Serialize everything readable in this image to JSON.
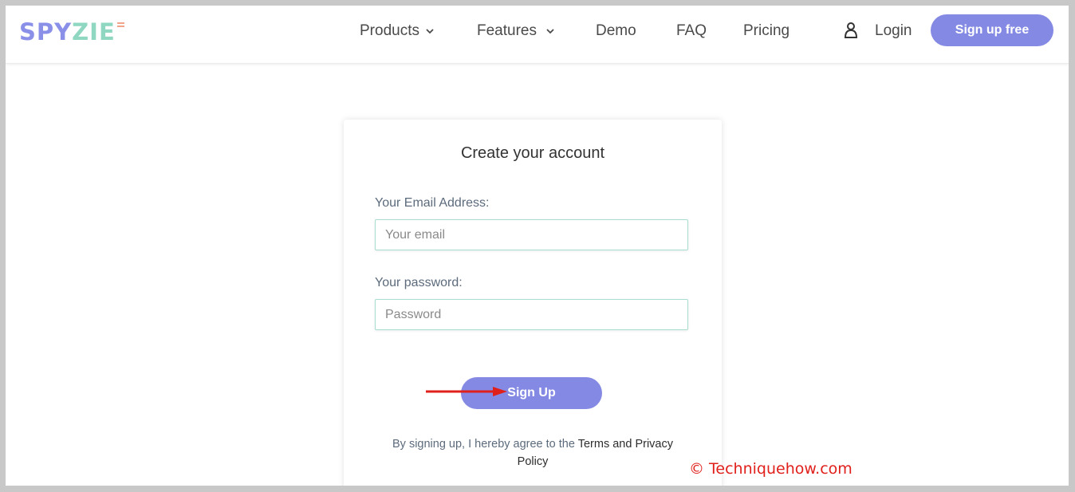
{
  "brand": {
    "logo_part1": "SPY",
    "logo_part2": "ZIE",
    "accent": "#8489e3",
    "accent2": "#8fd7c0"
  },
  "nav": {
    "products": "Products",
    "features": "Features",
    "demo": "Demo",
    "faq": "FAQ",
    "pricing": "Pricing",
    "login": "Login",
    "signup_free": "Sign up free"
  },
  "form": {
    "title": "Create your account",
    "email_label": "Your Email Address:",
    "email_placeholder": "Your email",
    "password_label": "Your password:",
    "password_placeholder": "Password",
    "submit": "Sign Up",
    "terms_prefix": "By signing up, I hereby agree to the",
    "terms_link": "Terms and Privacy Policy"
  },
  "watermark": "© Techniquehow.com",
  "icons": {
    "user": "user-icon",
    "chevron": "chevron-down-icon",
    "arrow": "red-arrow-icon"
  }
}
